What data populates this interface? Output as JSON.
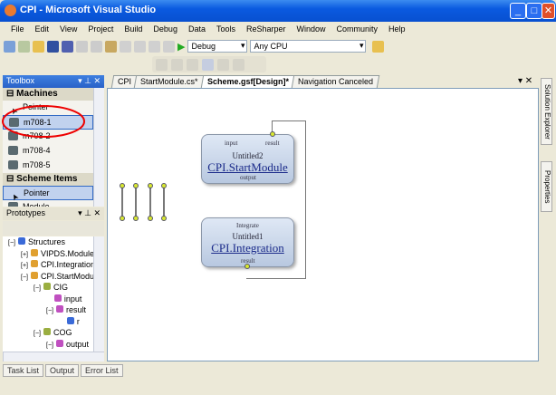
{
  "window": {
    "title": "CPI - Microsoft Visual Studio"
  },
  "menu": [
    "File",
    "Edit",
    "View",
    "Project",
    "Build",
    "Debug",
    "Data",
    "Tools",
    "ReSharper",
    "Window",
    "Community",
    "Help"
  ],
  "toolbar": {
    "config": "Debug",
    "platform": "Any CPU"
  },
  "toolbox": {
    "title": "Toolbox",
    "categories": [
      {
        "name": "Machines",
        "items": [
          "Pointer",
          "m708-1",
          "m708-2",
          "m708-4",
          "m708-5"
        ]
      },
      {
        "name": "Scheme Items",
        "items": [
          "Pointer",
          "Module"
        ]
      }
    ]
  },
  "prototypes": {
    "title": "Prototypes",
    "tree": [
      {
        "label": "Structures",
        "level": 0,
        "exp": "−"
      },
      {
        "label": "VIPDS.Module",
        "level": 1,
        "exp": "+"
      },
      {
        "label": "CPI.Integration",
        "level": 1,
        "exp": "+"
      },
      {
        "label": "CPI.StartModule",
        "level": 1,
        "exp": "−"
      },
      {
        "label": "CIG",
        "level": 2,
        "exp": "−"
      },
      {
        "label": "input",
        "level": 3,
        "exp": ""
      },
      {
        "label": "result",
        "level": 3,
        "exp": "−"
      },
      {
        "label": "r",
        "level": 4,
        "exp": ""
      },
      {
        "label": "COG",
        "level": 2,
        "exp": "−"
      },
      {
        "label": "output",
        "level": 3,
        "exp": "−"
      }
    ]
  },
  "tabs": [
    "CPI",
    "StartModule.cs*",
    "Scheme.gsf[Design]*",
    "Navigation Canceled"
  ],
  "active_tab": 2,
  "diagram": {
    "start": {
      "title": "Untitled2",
      "name": "CPI.StartModule",
      "ports": {
        "input": "input",
        "result": "result",
        "output": "output"
      }
    },
    "integ": {
      "title": "Untitled1",
      "name": "CPI.Integration",
      "ports": {
        "integrate": "Integrate",
        "result": "result"
      }
    }
  },
  "side_tabs": [
    "Solution Explorer",
    "Properties"
  ],
  "bottom_tabs": [
    "Task List",
    "Output",
    "Error List"
  ]
}
